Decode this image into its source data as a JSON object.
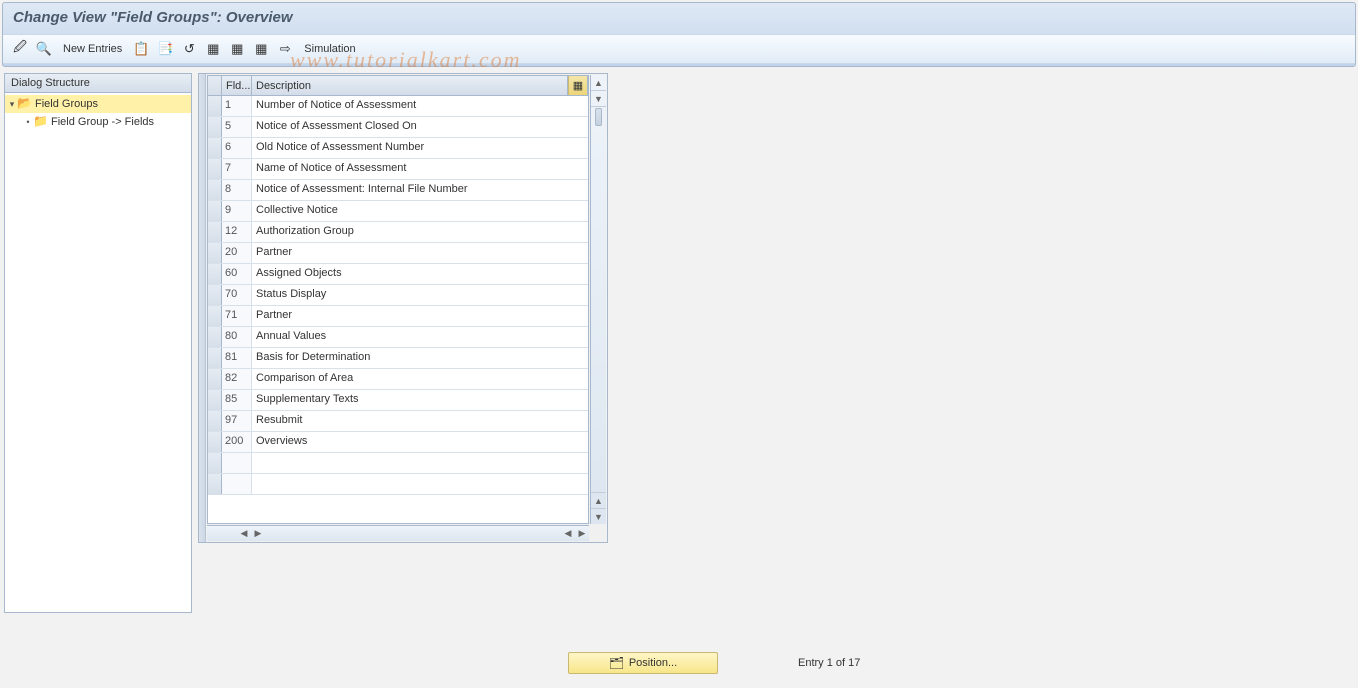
{
  "header": {
    "title": "Change View \"Field Groups\": Overview"
  },
  "toolbar": {
    "tools_icon": "🖉",
    "find_icon": "🔍",
    "new_entries_label": "New Entries",
    "copy_icon": "📋",
    "form_icon": "📑",
    "undo_icon": "↺",
    "spread1_icon": "▦",
    "spread2_icon": "▦",
    "spread3_icon": "▦",
    "export_icon": "⇨",
    "simulation_label": "Simulation"
  },
  "tree": {
    "header": "Dialog Structure",
    "items": [
      {
        "label": "Field Groups",
        "selected": true,
        "open": true,
        "level": 0
      },
      {
        "label": "Field Group -> Fields",
        "selected": false,
        "open": false,
        "level": 1
      }
    ]
  },
  "grid": {
    "columns": {
      "fld": "Fld...",
      "description": "Description",
      "opt_icon": "▦"
    },
    "rows": [
      {
        "fld": "1",
        "description": "Number of Notice of Assessment"
      },
      {
        "fld": "5",
        "description": "Notice of Assessment Closed On"
      },
      {
        "fld": "6",
        "description": "Old Notice of Assessment Number"
      },
      {
        "fld": "7",
        "description": "Name of Notice of Assessment"
      },
      {
        "fld": "8",
        "description": "Notice of Assessment: Internal File Number"
      },
      {
        "fld": "9",
        "description": "Collective Notice"
      },
      {
        "fld": "12",
        "description": "Authorization Group"
      },
      {
        "fld": "20",
        "description": "Partner"
      },
      {
        "fld": "60",
        "description": "Assigned Objects"
      },
      {
        "fld": "70",
        "description": "Status Display"
      },
      {
        "fld": "71",
        "description": "Partner"
      },
      {
        "fld": "80",
        "description": "Annual Values"
      },
      {
        "fld": "81",
        "description": "Basis for Determination"
      },
      {
        "fld": "82",
        "description": "Comparison of Area"
      },
      {
        "fld": "85",
        "description": "Supplementary Texts"
      },
      {
        "fld": "97",
        "description": "Resubmit"
      },
      {
        "fld": "200",
        "description": "Overviews"
      },
      {
        "fld": "",
        "description": ""
      },
      {
        "fld": "",
        "description": ""
      }
    ],
    "scroll": {
      "up": "▲",
      "down": "▼",
      "left": "◀",
      "right": "▶"
    }
  },
  "footer": {
    "position_button": "Position...",
    "position_icon": "🗂",
    "status": "Entry 1 of 17"
  },
  "watermark": "www.tutorialkart.com"
}
